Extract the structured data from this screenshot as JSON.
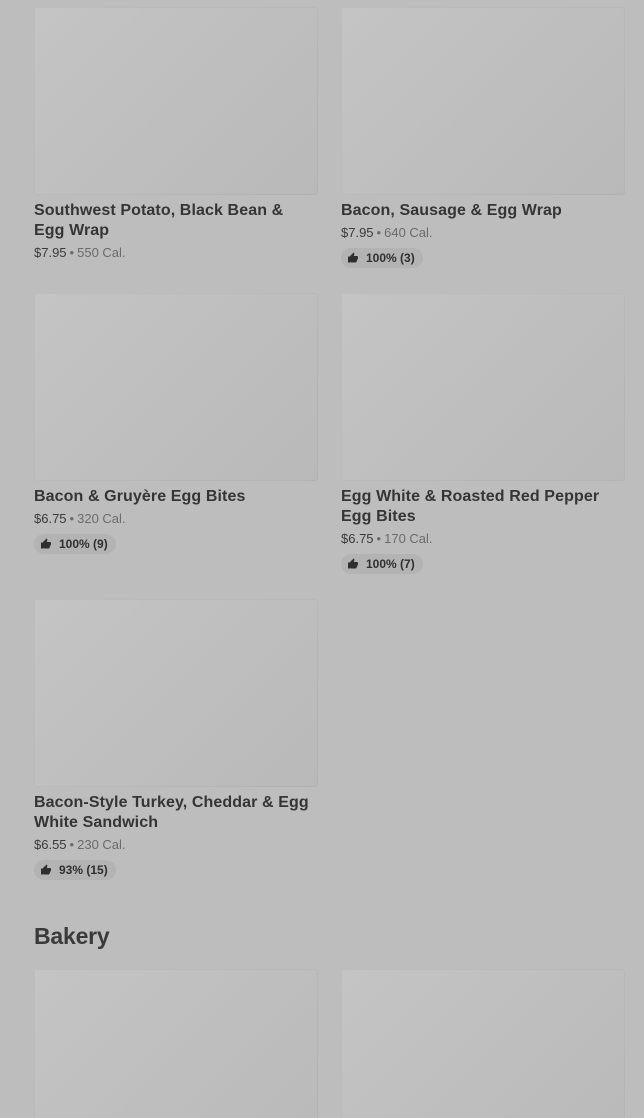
{
  "items": [
    {
      "name": "Southwest Potato, Black Bean & Egg Wrap",
      "price": "$7.95",
      "calories": "550 Cal.",
      "rating": ""
    },
    {
      "name": "Bacon, Sausage & Egg Wrap",
      "price": "$7.95",
      "calories": "640 Cal.",
      "rating": "100% (3)"
    },
    {
      "name": "Bacon & Gruyère Egg Bites",
      "price": "$6.75",
      "calories": "320 Cal.",
      "rating": "100% (9)"
    },
    {
      "name": "Egg White & Roasted Red Pepper Egg Bites",
      "price": "$6.75",
      "calories": "170 Cal.",
      "rating": "100% (7)"
    },
    {
      "name": "Bacon-Style Turkey, Cheddar & Egg White Sandwich",
      "price": "$6.55",
      "calories": "230 Cal.",
      "rating": "93% (15)"
    }
  ],
  "bakery": {
    "title": "Bakery"
  },
  "separator": "•",
  "icons": {
    "rating": "thumbs-up-icon"
  }
}
